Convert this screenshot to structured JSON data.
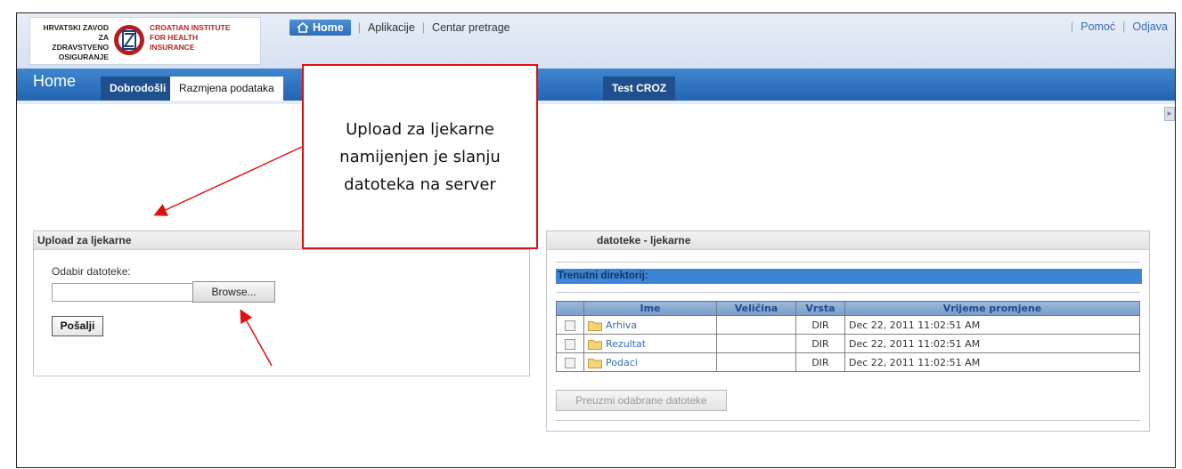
{
  "logo": {
    "left_lines": [
      "HRVATSKI ZAVOD ZA",
      "ZDRAVSTVENO",
      "OSIGURANJE"
    ],
    "right_lines": [
      "CROATIAN INSTITUTE",
      "FOR HEALTH",
      "INSURANCE"
    ]
  },
  "topnav": {
    "home": "Home",
    "items": [
      "Aplikacije",
      "Centar pretrage"
    ]
  },
  "rightnav": {
    "help": "Pomoć",
    "logout": "Odjava"
  },
  "tabs": {
    "section_title": "Home",
    "items": [
      "Dobrodošli",
      "Razmjena podataka",
      "Test CROZ"
    ]
  },
  "upload": {
    "title": "Upload za ljekarne",
    "file_label": "Odabir datoteke:",
    "browse": "Browse...",
    "send": "Pošalji"
  },
  "files": {
    "title_visible": "datoteke - ljekarne",
    "current_dir_label": "Trenutni direktorij:",
    "columns": [
      "Ime",
      "Veličina",
      "Vrsta",
      "Vrijeme promjene"
    ],
    "rows": [
      {
        "name": "Arhiva",
        "size": "",
        "type": "DIR",
        "modified": "Dec 22, 2011 11:02:51 AM"
      },
      {
        "name": "Rezultat",
        "size": "",
        "type": "DIR",
        "modified": "Dec 22, 2011 11:02:51 AM"
      },
      {
        "name": "Podaci",
        "size": "",
        "type": "DIR",
        "modified": "Dec 22, 2011 11:02:51 AM"
      }
    ],
    "download_button": "Preuzmi odabrane datoteke"
  },
  "callout": {
    "lines": [
      "Upload za ljekarne",
      "namijenjen je slanju",
      "datoteka na server"
    ]
  },
  "colors": {
    "tab_bar": "#2f77c2",
    "callout_border": "#dd1111",
    "link": "#3a6bb5",
    "current_dir_bar": "#3d84d6"
  },
  "icons": [
    "home-icon",
    "emblem-icon",
    "folder-icon",
    "checkbox-icon",
    "collapse-arrow-icon"
  ]
}
